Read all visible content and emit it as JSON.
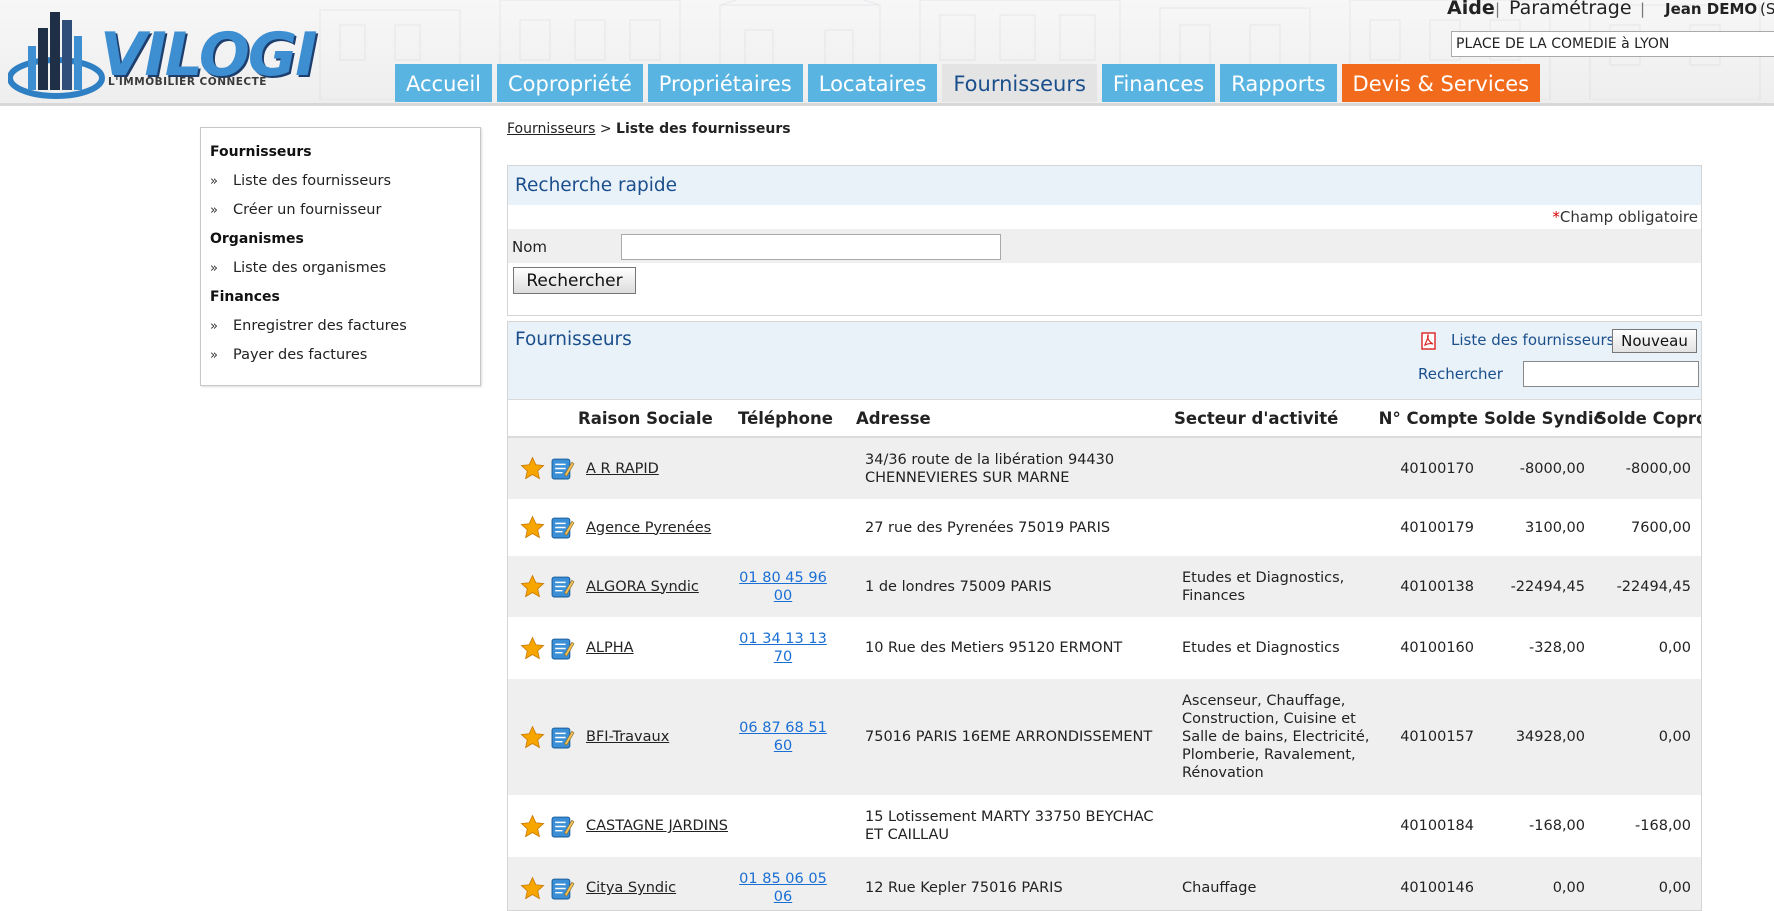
{
  "header": {
    "logo_text": "VILOGI",
    "logo_tagline": "L'IMMOBILIER CONNECTÉ",
    "help_link": "Aide",
    "separator": "|",
    "settings_link": "Paramétrage",
    "user_name": "Jean DEMO",
    "user_suffix": "(S",
    "building_selected": "PLACE DE LA COMEDIE à LYON",
    "tabs": [
      {
        "label": "Accueil"
      },
      {
        "label": "Copropriété"
      },
      {
        "label": "Propriétaires"
      },
      {
        "label": "Locataires"
      },
      {
        "label": "Fournisseurs"
      },
      {
        "label": "Finances"
      },
      {
        "label": "Rapports"
      },
      {
        "label": "Devis & Services"
      }
    ],
    "colors": {
      "tab": "#5ab4e2",
      "tab_active": "#e4e4e4",
      "tab_devis": "#f26b1d",
      "brand_blue": "#3d8fd1"
    }
  },
  "sidebar": {
    "bullet": "»",
    "sections": [
      {
        "title": "Fournisseurs",
        "items": [
          "Liste des fournisseurs",
          "Créer un fournisseur"
        ]
      },
      {
        "title": "Organismes",
        "items": [
          "Liste des organismes"
        ]
      },
      {
        "title": "Finances",
        "items": [
          "Enregistrer des factures",
          "Payer des factures"
        ]
      }
    ]
  },
  "breadcrumb": {
    "parent": "Fournisseurs",
    "separator": ">",
    "current": "Liste des fournisseurs"
  },
  "quick_search": {
    "title": "Recherche rapide",
    "required_star": "*",
    "required_note": "Champ obligatoire",
    "name_label": "Nom",
    "name_value": "",
    "search_button": "Rechercher"
  },
  "suppliers": {
    "title": "Fournisseurs",
    "pdf_link": "Liste des fournisseurs",
    "new_button": "Nouveau",
    "filter_label": "Rechercher",
    "filter_value": "",
    "columns": [
      "Raison Sociale",
      "Téléphone",
      "Adresse",
      "Secteur d'activité",
      "N° Compte",
      "Solde Syndic",
      "Solde Copro"
    ],
    "rows": [
      {
        "name": "A R RAPID",
        "phone": "",
        "address": "34/36 route de la libération 94430 CHENNEVIERES SUR MARNE",
        "sector": "",
        "account": "40100170",
        "syndic": "-8000,00",
        "copro": "-8000,00"
      },
      {
        "name": "Agence Pyrenées",
        "phone": "",
        "address": "27 rue des Pyrenées 75019 PARIS",
        "sector": "",
        "account": "40100179",
        "syndic": "3100,00",
        "copro": "7600,00"
      },
      {
        "name": "ALGORA Syndic",
        "phone": "01 80 45 96 00",
        "address": "1 de londres 75009 PARIS",
        "sector": "Etudes et Diagnostics, Finances",
        "account": "40100138",
        "syndic": "-22494,45",
        "copro": "-22494,45"
      },
      {
        "name": "ALPHA",
        "phone": "01 34 13 13 70",
        "address": "10 Rue des Metiers 95120 ERMONT",
        "sector": "Etudes et Diagnostics",
        "account": "40100160",
        "syndic": "-328,00",
        "copro": "0,00"
      },
      {
        "name": "BFI-Travaux",
        "phone": "06 87 68 51 60",
        "address": "75016 PARIS 16EME ARRONDISSEMENT",
        "sector": "Ascenseur, Chauffage, Construction, Cuisine et Salle de bains, Electricité, Plomberie, Ravalement, Rénovation",
        "account": "40100157",
        "syndic": "34928,00",
        "copro": "0,00"
      },
      {
        "name": "CASTAGNE JARDINS",
        "phone": "",
        "address": "15 Lotissement MARTY 33750 BEYCHAC ET CAILLAU",
        "sector": "",
        "account": "40100184",
        "syndic": "-168,00",
        "copro": "-168,00"
      },
      {
        "name": "Citya Syndic",
        "phone": "01 85 06 05 06",
        "address": "12 Rue Kepler 75016 PARIS",
        "sector": "Chauffage",
        "account": "40100146",
        "syndic": "0,00",
        "copro": "0,00"
      }
    ]
  }
}
